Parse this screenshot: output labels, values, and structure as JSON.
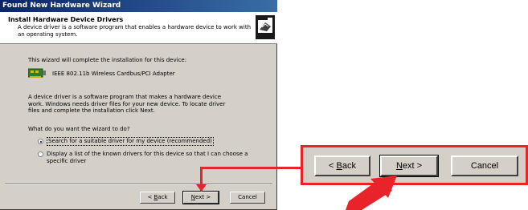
{
  "window": {
    "title": "Found New Hardware Wizard"
  },
  "header": {
    "title": "Install Hardware Device Drivers",
    "subtitle": "A device driver is a software program that enables a hardware device to work with an operating system."
  },
  "body": {
    "intro": "This wizard will complete the installation for this device:",
    "device_name": "IEEE 802.11b Wireless Cardbus/PCI Adapter",
    "explanation": "A device driver is a software program that makes a hardware device work. Windows needs driver files for your new device. To locate driver files and complete the installation click Next.",
    "question": "What do you want the wizard to do?"
  },
  "options": [
    {
      "label": "Search for a suitable driver for my device (recommended)",
      "selected": true
    },
    {
      "label": "Display a list of the known drivers for this device so that I can choose a specific driver",
      "selected": false
    }
  ],
  "buttons": {
    "back_prefix": "< ",
    "back_mnemonic": "B",
    "back_rest": "ack",
    "next_mnemonic": "N",
    "next_rest": "ext >",
    "cancel": "Cancel"
  },
  "colors": {
    "accent_red": "#e8242a",
    "titlebar": "#0a246a",
    "dialog_bg": "#d4d0c8"
  },
  "icons": {
    "device": "network-card-icon",
    "header": "hardware-wizard-icon",
    "arrow": "red-arrow-icon"
  }
}
